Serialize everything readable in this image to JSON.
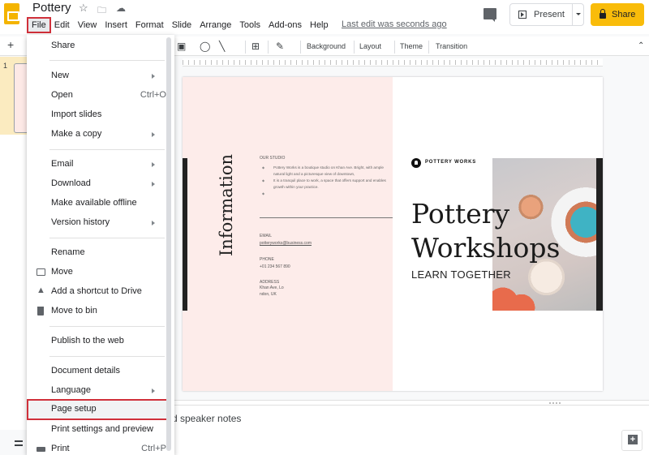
{
  "app": {
    "doc_title": "Pottery",
    "last_edit": "Last edit was seconds ago",
    "menu": [
      "File",
      "Edit",
      "View",
      "Insert",
      "Format",
      "Slide",
      "Arrange",
      "Tools",
      "Add-ons",
      "Help"
    ],
    "present_label": "Present",
    "share_label": "Share",
    "accent_color": "#f9bc0a",
    "highlight_color": "#d0303a"
  },
  "toolbar": {
    "background_label": "Background",
    "layout_label": "Layout",
    "theme_label": "Theme",
    "transition_label": "Transition"
  },
  "filmstrip": {
    "slide_number": "1"
  },
  "file_menu": {
    "items": [
      {
        "label": "Share"
      },
      {
        "label": "New",
        "submenu": true
      },
      {
        "label": "Open",
        "shortcut": "Ctrl+O"
      },
      {
        "label": "Import slides"
      },
      {
        "label": "Make a copy",
        "submenu": true
      },
      {
        "label": "Email",
        "submenu": true
      },
      {
        "label": "Download",
        "submenu": true
      },
      {
        "label": "Make available offline"
      },
      {
        "label": "Version history",
        "submenu": true
      },
      {
        "label": "Rename"
      },
      {
        "label": "Move",
        "icon": "move-folder-icon"
      },
      {
        "label": "Add a shortcut to Drive",
        "icon": "drive-shortcut-icon"
      },
      {
        "label": "Move to bin",
        "icon": "trash-icon"
      },
      {
        "label": "Publish to the web"
      },
      {
        "label": "Document details"
      },
      {
        "label": "Language",
        "submenu": true
      },
      {
        "label": "Page setup",
        "highlighted": true
      },
      {
        "label": "Print settings and preview"
      },
      {
        "label": "Print",
        "shortcut": "Ctrl+P",
        "icon": "print-icon"
      }
    ]
  },
  "slide": {
    "left_title": "Information",
    "our_studio_heading": "OUR STUDIO",
    "studio_bullets": [
      "Pottery Works is a boutique studio on Khan Ave. Bright, with ample natural light and a picturesque view of downtown,",
      "It is a tranquil place to work, a space that offers support and enables growth within your practice.",
      ""
    ],
    "email_label": "EMAIL",
    "email_value": "potteryworks@business.com",
    "phone_label": "PHONE",
    "phone_value": "+01 234 567 890",
    "address_label": "ADDRESS",
    "address_line1": "Khan Ave, Lo",
    "address_line2": "ndon, UK",
    "brand": "POTTERY WORKS",
    "title_line1": "Pottery",
    "title_line2": "Workshops",
    "subtitle": "LEARN TOGETHER"
  },
  "notes": {
    "placeholder_visible": "d speaker notes"
  }
}
